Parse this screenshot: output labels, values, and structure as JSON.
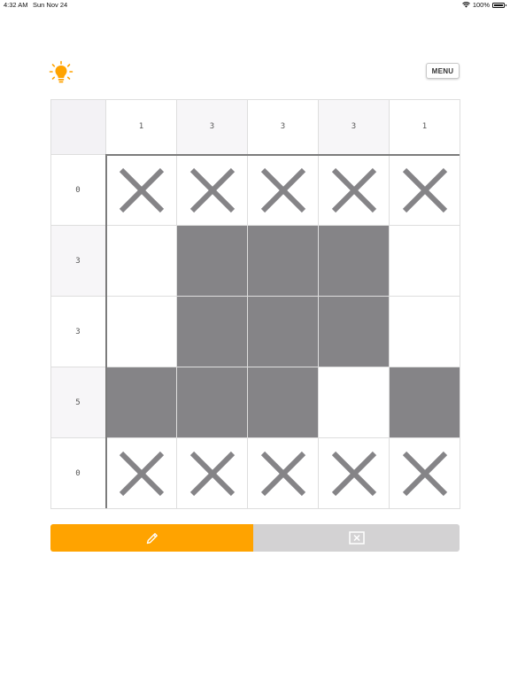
{
  "status_bar": {
    "time": "4:32 AM",
    "date": "Sun Nov 24",
    "battery": "100%"
  },
  "header": {
    "hint_icon": "lightbulb-icon",
    "menu_label": "MENU"
  },
  "puzzle": {
    "column_clues": [
      "1",
      "3",
      "3",
      "3",
      "1"
    ],
    "row_clues": [
      "0",
      "3",
      "3",
      "5",
      "0"
    ],
    "cells": [
      [
        "x",
        "x",
        "x",
        "x",
        "x"
      ],
      [
        ".",
        "f",
        "f",
        "f",
        "."
      ],
      [
        ".",
        "f",
        "f",
        "f",
        "."
      ],
      [
        "f",
        "f",
        "f",
        ".",
        "f"
      ],
      [
        "x",
        "x",
        "x",
        "x",
        "x"
      ]
    ]
  },
  "mode_toggle": {
    "active": "fill",
    "fill_icon": "pencil-icon",
    "cross_icon": "x-box-icon"
  },
  "colors": {
    "accent": "#ffa300",
    "filled": "#858487",
    "cross": "#858487",
    "inactive": "#d3d2d3"
  }
}
